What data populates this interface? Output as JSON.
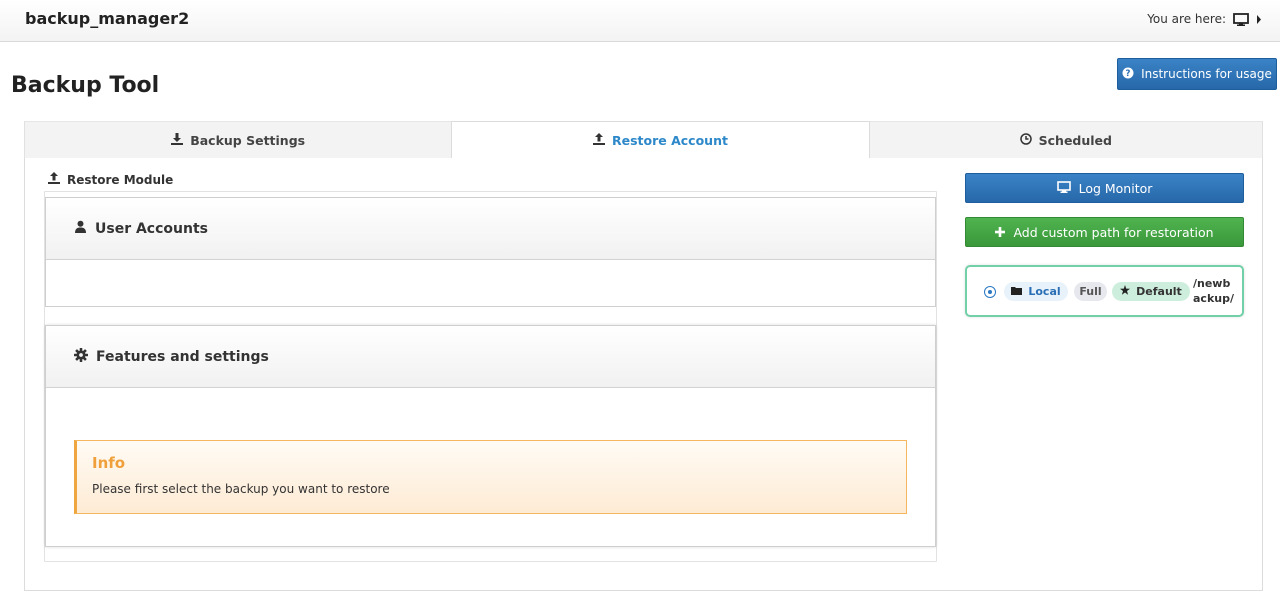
{
  "topbar": {
    "app_title": "backup_manager2",
    "breadcrumb_label": "You are here:"
  },
  "header": {
    "page_title": "Backup Tool",
    "instructions_label": "Instructions for usage"
  },
  "tabs": [
    {
      "label": "Backup Settings",
      "icon": "download-icon",
      "active": false
    },
    {
      "label": "Restore Account",
      "icon": "upload-icon",
      "active": true
    },
    {
      "label": "Scheduled",
      "icon": "clock-icon",
      "active": false
    }
  ],
  "restore": {
    "module_label": "Restore Module",
    "user_accounts_title": "User Accounts",
    "features_title": "Features and settings",
    "info": {
      "title": "Info",
      "text": "Please first select the backup you want to restore"
    }
  },
  "sidebar": {
    "log_monitor_label": "Log Monitor",
    "add_path_label": "Add custom path for restoration",
    "backup": {
      "location": "Local",
      "type": "Full",
      "badge": "Default",
      "path": "/newbackup/",
      "selected": true
    }
  },
  "colors": {
    "primary": "#2d7bc0",
    "success": "#45a845",
    "info_accent": "#f0a03a",
    "card_border": "#71d0a8",
    "active_tab_text": "#2d88c9"
  }
}
